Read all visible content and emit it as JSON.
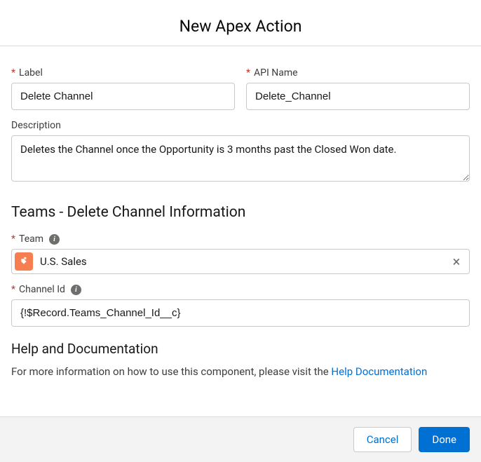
{
  "header": {
    "title": "New Apex Action"
  },
  "fields": {
    "label": {
      "label": "Label",
      "value": "Delete Channel"
    },
    "apiName": {
      "label": "API Name",
      "value": "Delete_Channel"
    },
    "description": {
      "label": "Description",
      "value": "Deletes the Channel once the Opportunity is 3 months past the Closed Won date."
    }
  },
  "section": {
    "title": "Teams - Delete Channel Information",
    "team": {
      "label": "Team",
      "value": "U.S. Sales"
    },
    "channelId": {
      "label": "Channel Id",
      "value": "{!$Record.Teams_Channel_Id__c}"
    }
  },
  "help": {
    "title": "Help and Documentation",
    "textPrefix": "For more information on how to use this component, please visit the ",
    "linkText": "Help Documentation"
  },
  "footer": {
    "cancel": "Cancel",
    "done": "Done"
  },
  "requiredMark": "*"
}
